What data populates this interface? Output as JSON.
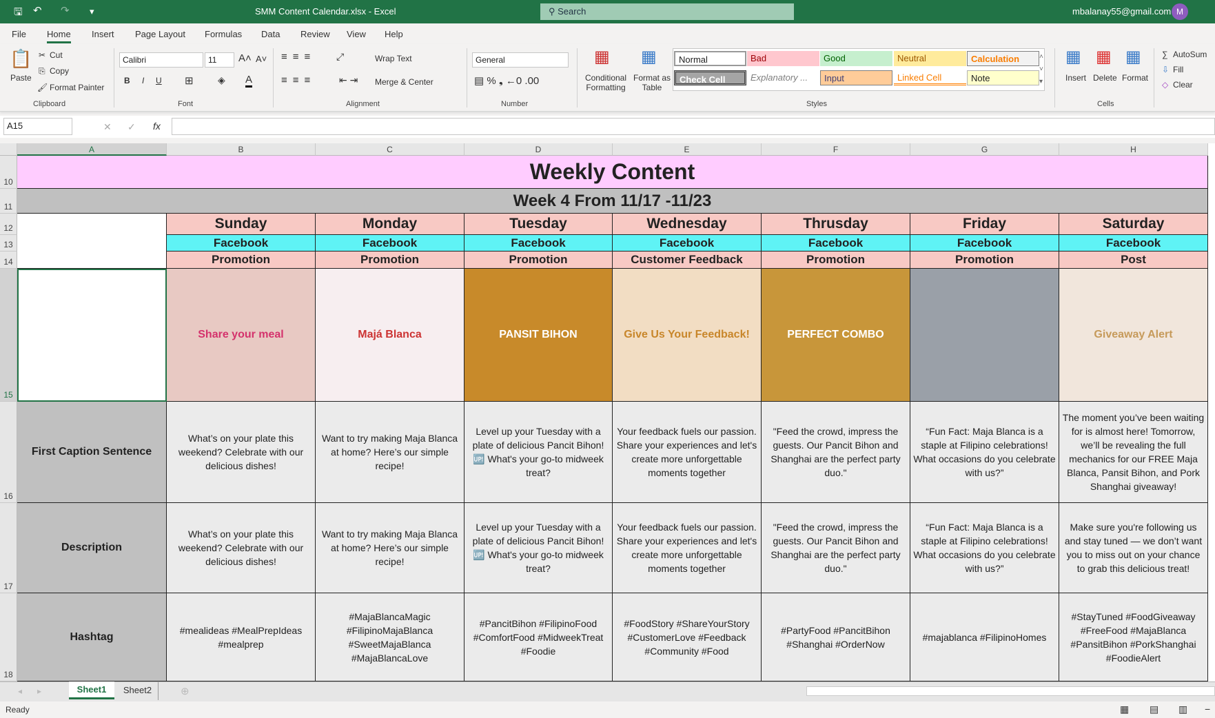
{
  "window": {
    "title": "SMM Content Calendar.xlsx  -  Excel",
    "search": "Search",
    "account": "mbalanay55@gmail.com",
    "avatar": "M"
  },
  "menu": [
    "File",
    "Home",
    "Insert",
    "Page Layout",
    "Formulas",
    "Data",
    "Review",
    "View",
    "Help"
  ],
  "ribbon": {
    "clipboard": {
      "paste": "Paste",
      "cut": "Cut",
      "copy": "Copy",
      "format_painter": "Format Painter",
      "label": "Clipboard"
    },
    "font": {
      "name": "Calibri",
      "size": "11",
      "label": "Font",
      "bold": "B",
      "italic": "I",
      "underline": "U"
    },
    "alignment": {
      "wrap": "Wrap Text",
      "merge": "Merge & Center",
      "label": "Alignment"
    },
    "number": {
      "format": "General",
      "label": "Number"
    },
    "styles": {
      "cond": "Conditional Formatting",
      "table": "Format as Table",
      "label": "Styles",
      "items": [
        "Normal",
        "Bad",
        "Good",
        "Neutral",
        "Calculation",
        "Check Cell",
        "Explanatory ...",
        "Input",
        "Linked Cell",
        "Note"
      ]
    },
    "cells": {
      "insert": "Insert",
      "delete": "Delete",
      "format": "Format",
      "label": "Cells"
    },
    "editing": {
      "autosum": "AutoSum",
      "fill": "Fill",
      "clear": "Clear"
    }
  },
  "formula_bar": {
    "name_box": "A15",
    "value": ""
  },
  "columns": [
    "A",
    "B",
    "C",
    "D",
    "E",
    "F",
    "G",
    "H"
  ],
  "rows": [
    "10",
    "11",
    "12",
    "13",
    "14",
    "15",
    "16",
    "17",
    "18"
  ],
  "sheet": {
    "title": "Weekly Content",
    "subtitle": "Week 4 From 11/17 -11/23",
    "days": [
      "Sunday",
      "Monday",
      "Tuesday",
      "Wednesday",
      "Thrusday",
      "Friday",
      "Saturday"
    ],
    "platforms": [
      "Facebook",
      "Facebook",
      "Facebook",
      "Facebook",
      "Facebook",
      "Facebook",
      "Facebook"
    ],
    "types": [
      "Promotion",
      "Promotion",
      "Promotion",
      "Customer Feedback",
      "Promotion",
      "Promotion",
      "Post"
    ],
    "images": [
      "Share your meal",
      "Majá Blanca",
      "PANSIT BIHON",
      "Give Us Your Feedback!",
      "PERFECT COMBO",
      "",
      "Giveaway Alert"
    ],
    "labels": [
      "First Caption Sentence",
      "Description",
      "Hashtag"
    ],
    "first_caption": [
      "What’s on your plate this weekend? Celebrate with our delicious dishes!",
      "Want to try making Maja Blanca at home? Here’s our simple recipe!",
      "Level up your Tuesday with a plate of delicious Pancit Bihon! 🆙 What's your go-to midweek treat?",
      "Your feedback fuels our passion. Share your experiences and let's create more unforgettable moments together",
      "\"Feed the crowd, impress the guests. Our Pancit Bihon and Shanghai are the perfect party duo.\"",
      "“Fun Fact: Maja Blanca is a staple at Filipino celebrations! What occasions do you celebrate with us?”",
      "The moment you’ve been waiting for is almost here! Tomorrow, we’ll be revealing the full mechanics for our FREE Maja Blanca, Pansit Bihon, and Pork Shanghai giveaway!"
    ],
    "description": [
      "What’s on your plate this weekend? Celebrate with our delicious dishes!",
      "Want to try making Maja Blanca at home? Here’s our simple recipe!",
      "Level up your Tuesday with a plate of delicious Pancit Bihon! 🆙 What's your go-to midweek treat?",
      "Your feedback fuels our passion. Share your experiences and let's create more unforgettable moments together",
      "\"Feed the crowd, impress the guests. Our Pancit Bihon and Shanghai are the perfect party duo.\"",
      "“Fun Fact: Maja Blanca is a staple at Filipino celebrations! What occasions do you celebrate with us?”",
      "Make sure you're following us and stay tuned — we don’t want you to miss out on your chance to grab this delicious treat!"
    ],
    "hashtags": [
      "#mealideas #MealPrepIdeas #mealprep",
      "#MajaBlancaMagic #FilipinoMajaBlanca #SweetMajaBlanca #MajaBlancaLove",
      "#PancitBihon #FilipinoFood #ComfortFood #MidweekTreat #Foodie",
      "#FoodStory #ShareYourStory #CustomerLove #Feedback #Community #Food",
      "#PartyFood #PancitBihon #Shanghai  #OrderNow",
      "#majablanca #FilipinoHomes",
      "#StayTuned #FoodGiveaway #FreeFood #MajaBlanca #PansitBihon #PorkShanghai #FoodieAlert"
    ]
  },
  "tabs": [
    "Sheet1",
    "Sheet2"
  ],
  "status": "Ready",
  "colors": {
    "brand": "#217346",
    "title_bg": "#ffccff",
    "subtitle_bg": "#c0c0c0",
    "day_bg": "#f8c9c4",
    "platform_bg": "#5ff3f5"
  }
}
